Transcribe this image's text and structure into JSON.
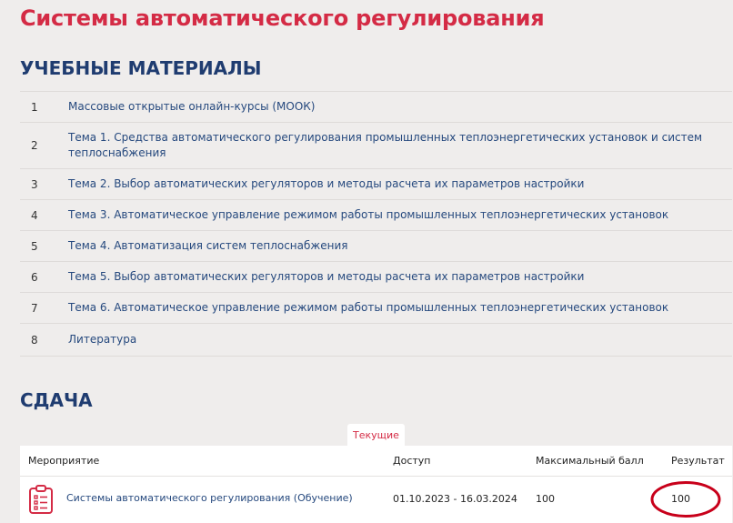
{
  "course": {
    "title": "Системы автоматического регулирования"
  },
  "materials": {
    "heading": "УЧЕБНЫЕ МАТЕРИАЛЫ",
    "items": [
      {
        "num": "1",
        "title": "Массовые открытые онлайн-курсы (МООК)"
      },
      {
        "num": "2",
        "title": "Тема 1. Средства автоматического регулирования промышленных теплоэнергетических установок и систем теплоснабжения"
      },
      {
        "num": "3",
        "title": "Тема 2. Выбор автоматических регуляторов и методы расчета их параметров настройки"
      },
      {
        "num": "4",
        "title": "Тема 3. Автоматическое управление режимом работы промышленных теплоэнергетических установок"
      },
      {
        "num": "5",
        "title": "Тема 4. Автоматизация систем теплоснабжения"
      },
      {
        "num": "6",
        "title": "Тема 5. Выбор автоматических регуляторов и методы расчета их параметров настройки"
      },
      {
        "num": "7",
        "title": "Тема 6. Автоматическое управление режимом работы промышленных теплоэнергетических установок"
      },
      {
        "num": "8",
        "title": "Литература"
      }
    ]
  },
  "submission": {
    "heading": "СДАЧА",
    "tab_label": "Текущие",
    "columns": {
      "event": "Мероприятие",
      "access": "Доступ",
      "max_score": "Максимальный балл",
      "result": "Результат"
    },
    "rows": [
      {
        "icon": "clipboard-checklist-icon",
        "event": "Системы автоматического регулирования (Обучение)",
        "access": "01.10.2023 - 16.03.2024",
        "max_score": "100",
        "result": "100"
      }
    ]
  },
  "colors": {
    "accent_red": "#d42b45",
    "heading_navy": "#1f3c70",
    "link_blue": "#26497e",
    "page_bg": "#efedec",
    "annotation_red": "#c8001a"
  }
}
